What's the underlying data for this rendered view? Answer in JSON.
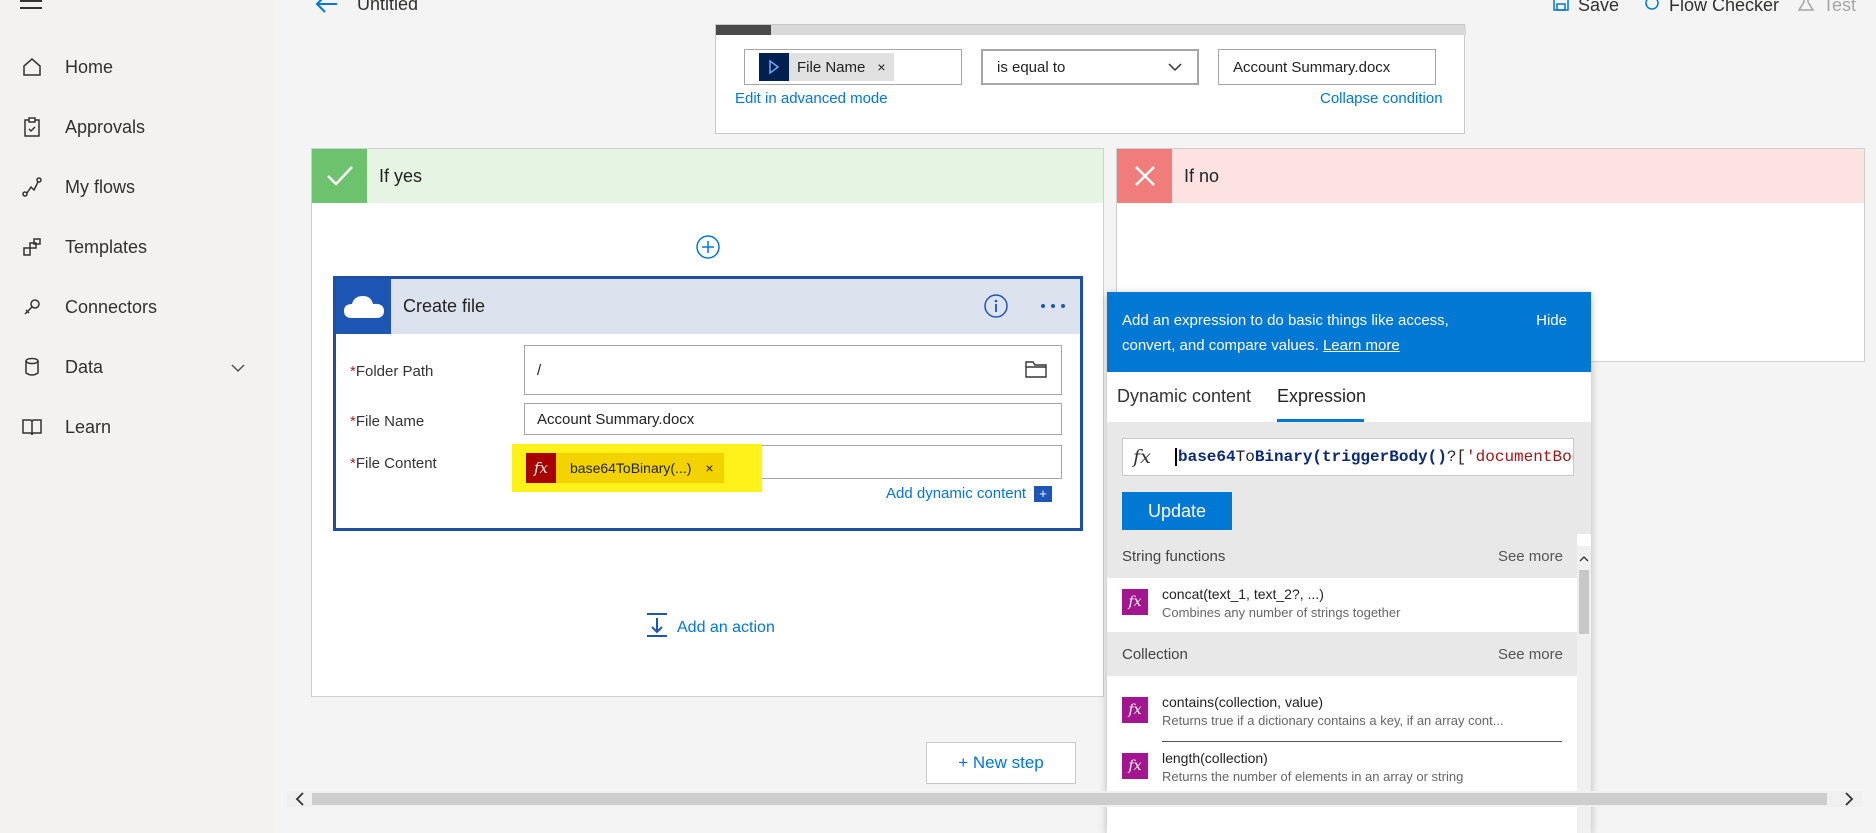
{
  "nav": {
    "items": [
      {
        "label": "Home",
        "icon": "home-icon"
      },
      {
        "label": "Approvals",
        "icon": "approvals-icon"
      },
      {
        "label": "My flows",
        "icon": "flows-icon"
      },
      {
        "label": "Templates",
        "icon": "templates-icon"
      },
      {
        "label": "Connectors",
        "icon": "connectors-icon"
      },
      {
        "label": "Data",
        "icon": "data-icon"
      },
      {
        "label": "Learn",
        "icon": "learn-icon"
      }
    ]
  },
  "header": {
    "title": "Untitled",
    "save_label": "Save",
    "checker_label": "Flow Checker",
    "test_label": "Test"
  },
  "condition": {
    "left_token": "File Name",
    "token_remove": "×",
    "operator": "is equal to",
    "value": "Account Summary.docx",
    "edit_advanced": "Edit in advanced mode",
    "collapse": "Collapse condition"
  },
  "branches": {
    "yes_title": "If yes",
    "no_title": "If no",
    "yes_color": "#5cb85c",
    "no_color": "#f07c7c"
  },
  "create_file": {
    "title": "Create file",
    "folder_label": "Folder Path",
    "folder_value": "/",
    "name_label": "File Name",
    "name_value": "Account Summary.docx",
    "content_label": "File Content",
    "content_token": "base64ToBinary(...)",
    "content_token_remove": "×",
    "add_dynamic": "Add dynamic content",
    "required_mark": "*"
  },
  "actions": {
    "add_action": "Add an action",
    "new_step": "+ New step"
  },
  "expression_panel": {
    "banner_text": "Add an expression to do basic things like access, convert, and compare values.",
    "learn_more": "Learn more",
    "hide": "Hide",
    "tabs": [
      "Dynamic content",
      "Expression"
    ],
    "active_tab": "Expression",
    "expression_parts": {
      "p1": "base64",
      "p2": "To",
      "p3": "Binary(triggerBody()",
      "p4": "?[",
      "p5": "'documentBody'"
    },
    "update": "Update",
    "sections": [
      {
        "title": "String functions",
        "see_more": "See more",
        "functions": [
          {
            "name": "concat(text_1, text_2?, ...)",
            "desc": "Combines any number of strings together"
          }
        ]
      },
      {
        "title": "Collection",
        "see_more": "See more",
        "functions": [
          {
            "name": "contains(collection, value)",
            "desc": "Returns true if a dictionary contains a key, if an array cont..."
          },
          {
            "name": "length(collection)",
            "desc": "Returns the number of elements in an array or string"
          }
        ]
      }
    ]
  },
  "colors": {
    "accent": "#0078d4",
    "card_border": "#1e4fa0",
    "highlight": "#fff11a",
    "fx_purple": "#a2168f"
  }
}
